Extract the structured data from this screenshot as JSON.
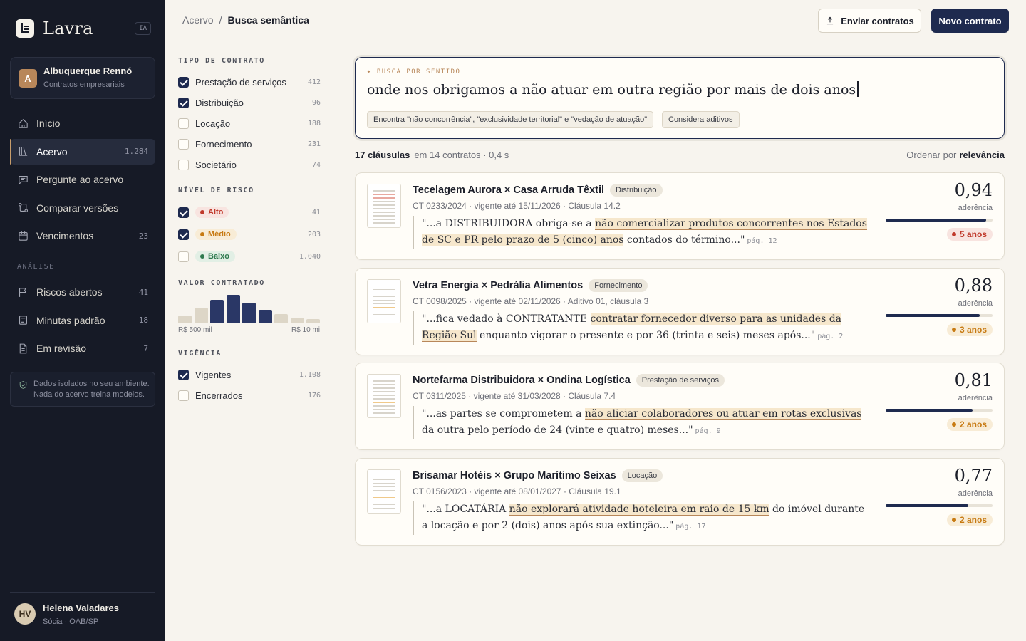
{
  "app": {
    "name": "Lavra",
    "badge": "IA"
  },
  "org": {
    "initial": "A",
    "name": "Albuquerque Rennó",
    "sub": "Contratos empresariais"
  },
  "nav": [
    {
      "label": "Início",
      "count": "",
      "icon": "home-icon"
    },
    {
      "label": "Acervo",
      "count": "1.284",
      "icon": "library-icon",
      "active": true
    },
    {
      "label": "Pergunte ao acervo",
      "count": "",
      "icon": "chat-icon"
    },
    {
      "label": "Comparar versões",
      "count": "",
      "icon": "compare-icon"
    },
    {
      "label": "Vencimentos",
      "count": "23",
      "icon": "calendar-icon"
    }
  ],
  "analysis": {
    "title": "ANÁLISE",
    "items": [
      {
        "label": "Riscos abertos",
        "count": "41",
        "icon": "flag-icon"
      },
      {
        "label": "Minutas padrão",
        "count": "18",
        "icon": "template-icon"
      },
      {
        "label": "Em revisão",
        "count": "7",
        "icon": "document-icon"
      }
    ]
  },
  "privacy": "Dados isolados no seu ambiente. Nada do acervo treina modelos.",
  "user": {
    "initials": "HV",
    "name": "Helena Valadares",
    "role": "Sócia · OAB/SP"
  },
  "breadcrumb": {
    "parent": "Acervo",
    "sep": "/",
    "current": "Busca semântica"
  },
  "toolbar": {
    "upload_label": "Enviar contratos",
    "new_label": "Novo contrato"
  },
  "filters": {
    "type": {
      "title": "TIPO DE CONTRATO",
      "items": [
        {
          "label": "Prestação de serviços",
          "count": "412",
          "checked": true
        },
        {
          "label": "Distribuição",
          "count": "96",
          "checked": true
        },
        {
          "label": "Locação",
          "count": "188",
          "checked": false
        },
        {
          "label": "Fornecimento",
          "count": "231",
          "checked": false
        },
        {
          "label": "Societário",
          "count": "74",
          "checked": false
        }
      ]
    },
    "risk": {
      "title": "NÍVEL DE RISCO",
      "items": [
        {
          "label": "Alto",
          "count": "41",
          "checked": true,
          "color": "#c0392b",
          "bg": "#f8e4e0"
        },
        {
          "label": "Médio",
          "count": "203",
          "checked": true,
          "color": "#c77a12",
          "bg": "#f8ecd6"
        },
        {
          "label": "Baixo",
          "count": "1.040",
          "checked": false,
          "color": "#2f7a4f",
          "bg": "#e2efe5"
        }
      ]
    },
    "value": {
      "title": "VALOR CONTRATADO",
      "min_label": "R$ 500 mil",
      "max_label": "R$ 10 mi",
      "bars": [
        {
          "level": 0.28,
          "selected": false
        },
        {
          "level": 0.55,
          "selected": false
        },
        {
          "level": 0.82,
          "selected": true
        },
        {
          "level": 1.0,
          "selected": true
        },
        {
          "level": 0.72,
          "selected": true
        },
        {
          "level": 0.48,
          "selected": true
        },
        {
          "level": 0.32,
          "selected": false
        },
        {
          "level": 0.2,
          "selected": false
        },
        {
          "level": 0.14,
          "selected": false
        }
      ]
    },
    "term": {
      "title": "VIGÊNCIA",
      "items": [
        {
          "label": "Vigentes",
          "count": "1.108",
          "checked": true
        },
        {
          "label": "Encerrados",
          "count": "176",
          "checked": false
        }
      ]
    }
  },
  "search": {
    "hint": "✦ BUSCA POR SENTIDO",
    "query": "onde nos obrigamos a não atuar em outra região por mais de dois anos",
    "chips": [
      "Encontra \"não concorrência\", \"exclusividade territorial\" e \"vedação de atuação\"",
      "Considera aditivos"
    ]
  },
  "summary": {
    "count": "17 cláusulas",
    "detail": "em 14 contratos · 0,4 s",
    "sort_label": "Ordenar por",
    "sort_value": "relevância"
  },
  "results": [
    {
      "title": "Tecelagem Aurora × Casa Arruda Têxtil",
      "tag": "Distribuição",
      "meta": "CT 0233/2024 · vigente até 15/11/2026 · Cláusula 14.2",
      "pre": "\"...a DISTRIBUIDORA obriga-se a ",
      "mark": "não comercializar produtos concorrentes nos Estados de SC e PR pelo prazo de 5 (cinco) anos",
      "post": " contados do término...\"",
      "page": "pág. 12",
      "score": "0,94",
      "score_value": 0.94,
      "adh": "aderência",
      "duration": "5 anos",
      "risk_color": "#c0392b",
      "risk_bg": "#f8e4e0"
    },
    {
      "title": "Vetra Energia × Pedrália Alimentos",
      "tag": "Fornecimento",
      "meta": "CT 0098/2025 · vigente até 02/11/2026 · Aditivo 01, cláusula 3",
      "pre": "\"...fica vedado à CONTRATANTE ",
      "mark": "contratar fornecedor diverso para as unidades da Região Sul",
      "post": " enquanto vigorar o presente e por 36 (trinta e seis) meses após...\"",
      "page": "pág. 2",
      "score": "0,88",
      "score_value": 0.88,
      "adh": "aderência",
      "duration": "3 anos",
      "risk_color": "#c77a12",
      "risk_bg": "#f8ecd6"
    },
    {
      "title": "Nortefarma Distribuidora × Ondina Logística",
      "tag": "Prestação de serviços",
      "meta": "CT 0311/2025 · vigente até 31/03/2028 · Cláusula 7.4",
      "pre": "\"...as partes se comprometem a ",
      "mark": "não aliciar colaboradores ou atuar em rotas exclusivas",
      "post": " da outra pelo período de 24 (vinte e quatro) meses...\"",
      "page": "pág. 9",
      "score": "0,81",
      "score_value": 0.81,
      "adh": "aderência",
      "duration": "2 anos",
      "risk_color": "#c77a12",
      "risk_bg": "#f8ecd6"
    },
    {
      "title": "Brisamar Hotéis × Grupo Marítimo Seixas",
      "tag": "Locação",
      "meta": "CT 0156/2023 · vigente até 08/01/2027 · Cláusula 19.1",
      "pre": "\"...a LOCATÁRIA ",
      "mark": "não explorará atividade hoteleira em raio de 15 km",
      "post": " do imóvel durante a locação e por 2 (dois) anos após sua extinção...\"",
      "page": "pág. 17",
      "score": "0,77",
      "score_value": 0.77,
      "adh": "aderência",
      "duration": "2 anos",
      "risk_color": "#c77a12",
      "risk_bg": "#f8ecd6"
    }
  ]
}
